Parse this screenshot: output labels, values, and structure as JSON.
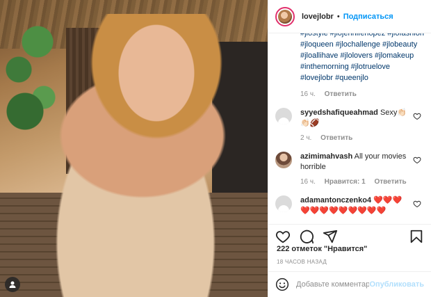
{
  "post": {
    "username": "lovejlobr",
    "separator": "•",
    "follow_label": "Подписаться"
  },
  "caption": {
    "hashtags": "#jlostyle #jlojenniferlopez #jlofashion #jloqueen #jlochallenge #jlobeauty #jloallihave #jlolovers #jlomakeup #inthemorning #jlotruelove #lovejlobr #queenjlo",
    "time": "16 ч.",
    "reply_label": "Ответить"
  },
  "comments": [
    {
      "username": "syyedshafiqueahmad",
      "text": "Sexy👏🏻👏🏻🏈",
      "time": "2 ч.",
      "likes": "",
      "reply_label": "Ответить"
    },
    {
      "username": "azimimahvash",
      "text": "All your movies horrible",
      "time": "16 ч.",
      "likes": "Нравится: 1",
      "reply_label": "Ответить"
    },
    {
      "username": "adamantonczenko4",
      "text": "❤️❤️❤️❤️❤️❤️❤️❤️❤️❤️❤️❤️",
      "time": "",
      "likes": "",
      "reply_label": ""
    }
  ],
  "likes_text": "222 отметок \"Нравится\"",
  "timestamp": "18 ЧАСОВ НАЗАД",
  "add_comment": {
    "placeholder": "Добавьте комментарий...",
    "publish_label": "Опубликовать"
  },
  "icons": {
    "heart": "heart-icon",
    "comment": "comment-icon",
    "share": "share-icon",
    "bookmark": "bookmark-icon",
    "smile": "emoji-icon",
    "user_tag": "user-tag-icon"
  },
  "colors": {
    "link": "#0095f6",
    "hashtag": "#00376b",
    "muted": "#8e8e8e",
    "publish_disabled": "#b2dffc"
  }
}
